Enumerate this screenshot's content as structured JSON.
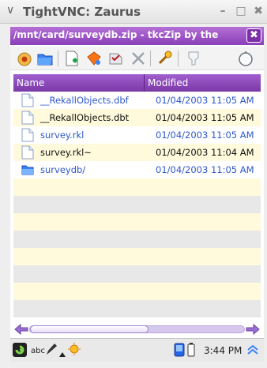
{
  "window": {
    "title": "TightVNC: Zaurus",
    "menu_glyph": "∨",
    "minimize_glyph": "–",
    "maximize_glyph": "□",
    "close_glyph": "✖"
  },
  "app": {
    "title": "/mnt/card/surveydb.zip - tkcZip by the",
    "close_glyph": "✖",
    "accent_color": "#9a4fc9"
  },
  "toolbar": {
    "buttons": [
      "open-icon",
      "open-folder-icon",
      "add-file-icon",
      "extract-icon",
      "test-icon",
      "delete-icon",
      "properties-icon",
      "filter-icon",
      "about-icon"
    ]
  },
  "table": {
    "columns": [
      "Name",
      "Modified"
    ],
    "rows": [
      {
        "name": "__RekallObjects.dbf",
        "modified": "01/04/2003 11:05 AM",
        "icon": "file-icon",
        "color": "blue"
      },
      {
        "name": "__RekallObjects.dbt",
        "modified": "01/04/2003 11:05 AM",
        "icon": "file-icon",
        "color": "black"
      },
      {
        "name": "survey.rkl",
        "modified": "01/04/2003 11:05 AM",
        "icon": "file-icon",
        "color": "blue"
      },
      {
        "name": "survey.rkl~",
        "modified": "01/04/2003 11:04 AM",
        "icon": "file-icon",
        "color": "black"
      },
      {
        "name": "surveydb/",
        "modified": "01/04/2003 11:05 AM",
        "icon": "folder-icon",
        "color": "blue"
      }
    ]
  },
  "taskbar": {
    "input_method": "abc",
    "clock": "3:44 PM"
  }
}
